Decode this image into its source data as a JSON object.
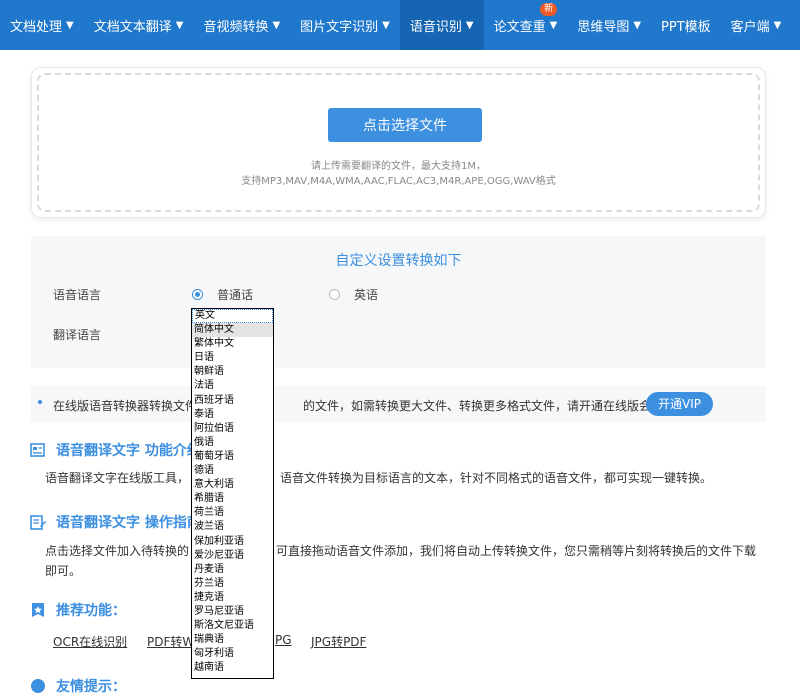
{
  "nav": {
    "items": [
      {
        "label": "文档处理",
        "caret": true
      },
      {
        "label": "文档文本翻译",
        "caret": true
      },
      {
        "label": "音视频转换",
        "caret": true
      },
      {
        "label": "图片文字识别",
        "caret": true
      },
      {
        "label": "语音识别",
        "caret": true,
        "active": true
      },
      {
        "label": "论文查重",
        "caret": true,
        "badge": "新"
      },
      {
        "label": "思维导图",
        "caret": true
      },
      {
        "label": "PPT模板",
        "caret": false
      },
      {
        "label": "客户端",
        "caret": true
      }
    ]
  },
  "upload": {
    "button_label": "点击选择文件",
    "hint_line1": "请上传需要翻译的文件，最大支持1M，",
    "hint_line2": "支持MP3,MAV,M4A,WMA,AAC,FLAC,AC3,M4R,APE,OGG,WAV格式"
  },
  "settings": {
    "title": "自定义设置转换如下",
    "voice_language_label": "语音语言",
    "voice_options": [
      {
        "label": "普通话",
        "checked": true
      },
      {
        "label": "英语",
        "checked": false
      }
    ],
    "translate_language_label": "翻译语言"
  },
  "notice": {
    "text_part1": "在线版语音转换器转换文件",
    "text_part2": "的文件，如需转换更大文件、转换更多格式文件，请开通在线版会员。",
    "vip_button": "开通VIP"
  },
  "intro": {
    "title": "语音翻译文字 功能介绍",
    "text_part1": "语音翻译文字在线版工具，",
    "text_part2": "语音文件转换为目标语言的文本，针对不同格式的语音文件，都可实现一键转换。"
  },
  "guide": {
    "title": "语音翻译文字 操作指南",
    "text_part1": "点击选择文件加入待转换的",
    "text_part2": "可直接拖动语音文件添加，我们将自动上传转换文件，您只需稍等片刻将转换后的文件下载",
    "text_line2": "即可。"
  },
  "recommend": {
    "title": "推荐功能：",
    "links": [
      "OCR在线识别",
      "PDF转W",
      "PG",
      "JPG转PDF"
    ]
  },
  "tips": {
    "title": "友情提示："
  },
  "dropdown": {
    "selected": "英文",
    "hovered": "简体中文",
    "options": [
      "英文",
      "简体中文",
      "繁体中文",
      "日语",
      "朝鲜语",
      "法语",
      "西班牙语",
      "泰语",
      "阿拉伯语",
      "俄语",
      "葡萄牙语",
      "德语",
      "意大利语",
      "希腊语",
      "荷兰语",
      "波兰语",
      "保加利亚语",
      "爱沙尼亚语",
      "丹麦语",
      "芬兰语",
      "捷克语",
      "罗马尼亚语",
      "斯洛文尼亚语",
      "瑞典语",
      "匈牙利语",
      "越南语"
    ]
  },
  "colors": {
    "nav_bg": "#1f78cb",
    "nav_active": "#1565b3",
    "accent": "#3d8fe0",
    "badge": "#f05a28"
  }
}
